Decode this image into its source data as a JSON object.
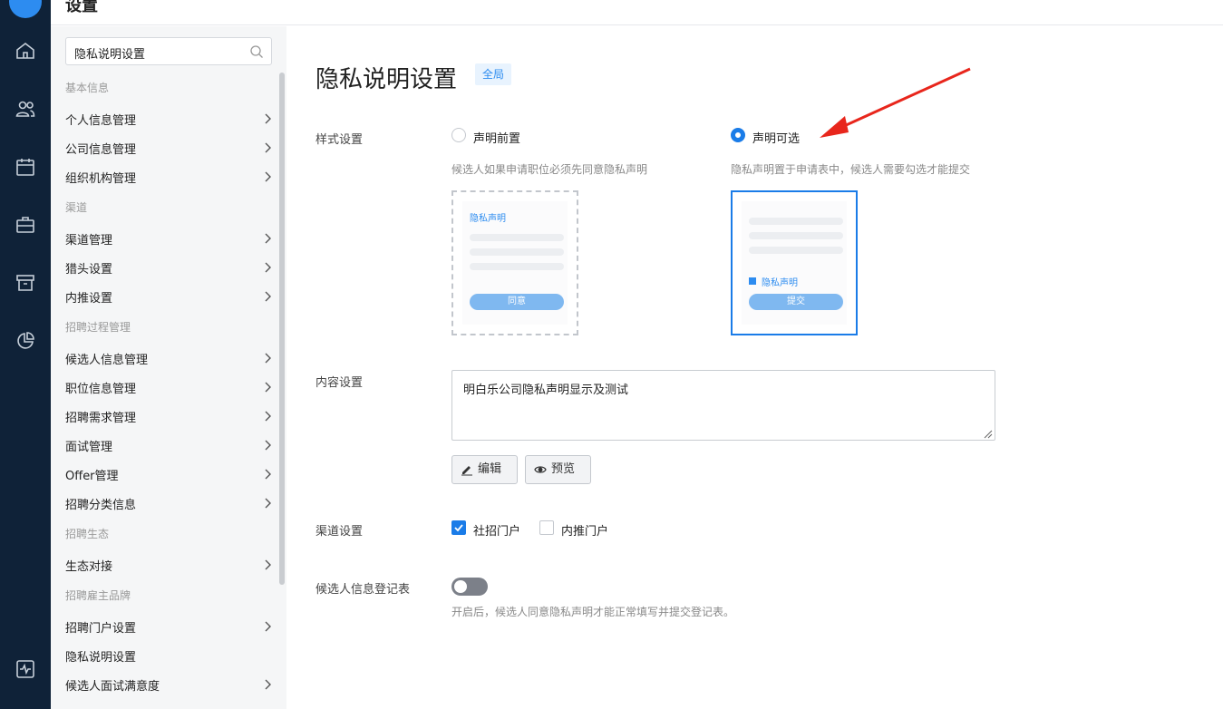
{
  "topbar": {
    "title": "设置"
  },
  "sidebar": {
    "search_value": "隐私说明设置",
    "groups": [
      "基本信息",
      "渠道",
      "招聘过程管理",
      "招聘生态",
      "招聘雇主品牌"
    ],
    "items": [
      "个人信息管理",
      "公司信息管理",
      "组织机构管理",
      "渠道管理",
      "猎头设置",
      "内推设置",
      "候选人信息管理",
      "职位信息管理",
      "招聘需求管理",
      "面试管理",
      "Offer管理",
      "招聘分类信息",
      "生态对接",
      "招聘门户设置",
      "隐私说明设置",
      "候选人面试满意度"
    ]
  },
  "main": {
    "title": "隐私说明设置",
    "badge": "全局",
    "style_label": "样式设置",
    "option_a": {
      "label": "声明前置",
      "desc": "候选人如果申请职位必须先同意隐私声明",
      "preview_title": "隐私声明",
      "preview_button": "同意",
      "selected": false
    },
    "option_b": {
      "label": "声明可选",
      "desc": "隐私声明置于申请表中，候选人需要勾选才能提交",
      "preview_check": "隐私声明",
      "preview_button": "提交",
      "selected": true
    },
    "content_label": "内容设置",
    "content_value": "明白乐公司隐私声明显示及测试",
    "edit_button": "编辑",
    "preview_button": "预览",
    "channel_label": "渠道设置",
    "channel_social": {
      "label": "社招门户",
      "checked": true
    },
    "channel_referral": {
      "label": "内推门户",
      "checked": false
    },
    "registry_label": "候选人信息登记表",
    "registry_toggle_on": false,
    "registry_desc": "开启后，候选人同意隐私声明才能正常填写并提交登记表。"
  },
  "colors": {
    "accent": "#1a7ce8",
    "rail": "#0f2238",
    "arrow": "#e8261c"
  },
  "icons": [
    "home-icon",
    "users-icon",
    "calendar-icon",
    "briefcase-icon",
    "archive-icon",
    "pie-chart-icon",
    "activity-icon",
    "search-icon",
    "chevron-right-icon",
    "edit-icon",
    "eye-icon"
  ]
}
